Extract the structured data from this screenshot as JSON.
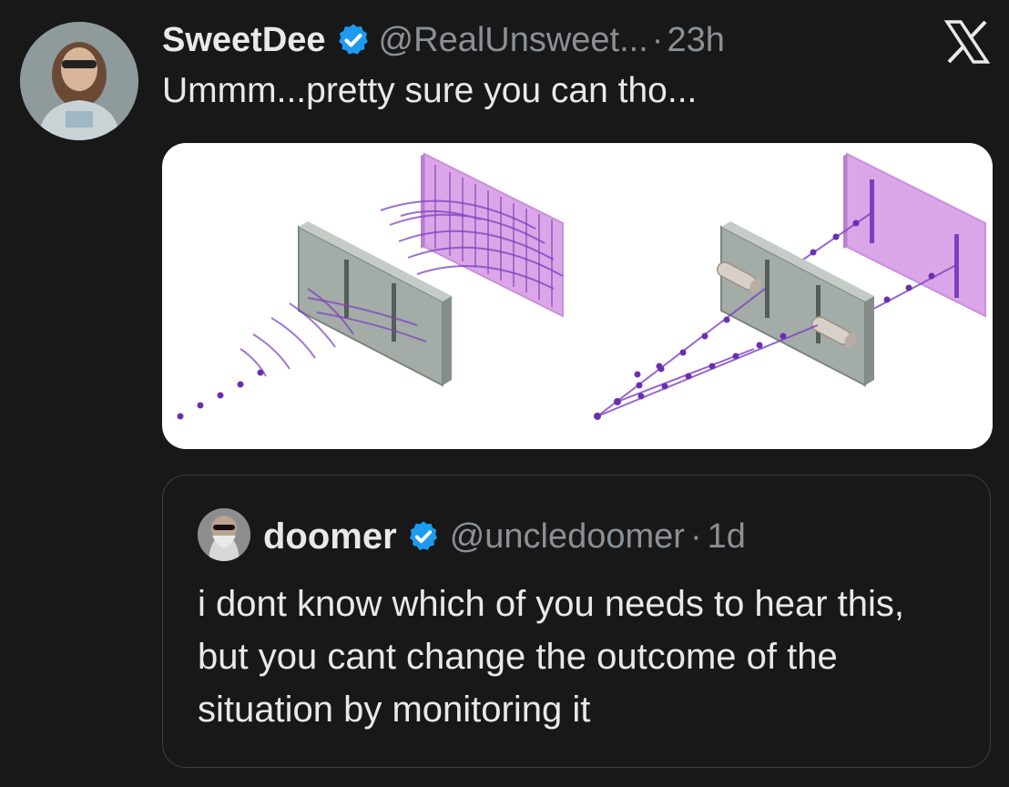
{
  "post": {
    "display_name": "SweetDee",
    "handle": "@RealUnsweet...",
    "separator": "·",
    "time": "23h",
    "text": "Ummm...pretty sure you can tho..."
  },
  "quoted_post": {
    "display_name": "doomer",
    "handle": "@uncledoomer",
    "separator": "·",
    "time": "1d",
    "text": "i dont know which of you needs to hear this, but you cant change the outcome of the situation by monitoring it"
  },
  "icons": {
    "verified": "verified-badge-icon",
    "platform": "x-logo-icon"
  },
  "colors": {
    "background": "#181818",
    "verified_blue": "#1d9bf0",
    "muted_text": "#8b9095",
    "primary_text": "#e7e9ea",
    "wave_purple": "#7b3fbf",
    "screen_pink": "#d9a3e6",
    "barrier_gray": "#9aa3a0"
  }
}
